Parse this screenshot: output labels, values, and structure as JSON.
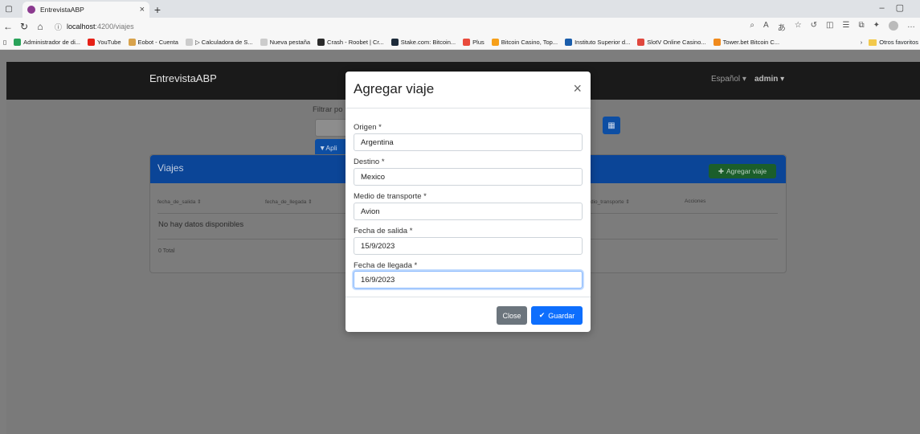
{
  "browser": {
    "tab_title": "EntrevistaABP",
    "url_host": "localhost",
    "url_path": ":4200/viajes",
    "bookmarks": [
      {
        "label": "Administrador de di...",
        "color": "#2aa35a"
      },
      {
        "label": "YouTube",
        "color": "#e62117"
      },
      {
        "label": "Eobot - Cuenta",
        "color": "#d8a24c"
      },
      {
        "label": "▷ Calculadora de S...",
        "color": "#cccccc"
      },
      {
        "label": "Nueva pestaña",
        "color": "#cccccc"
      },
      {
        "label": "Crash - Roobet | Cr...",
        "color": "#2b2b2b"
      },
      {
        "label": "Stake.com: Bitcoin...",
        "color": "#1d2b3a"
      },
      {
        "label": "Plus",
        "color": "#e94b3c"
      },
      {
        "label": "Bitcoin Casino, Top...",
        "color": "#f6a01a"
      },
      {
        "label": "Instituto Superior d...",
        "color": "#1a5dab"
      },
      {
        "label": "SlotV Online Casino...",
        "color": "#e0483e"
      },
      {
        "label": "Tower.bet Bitcoin C...",
        "color": "#f08a1c"
      }
    ],
    "other_favorites": "Otros favoritos"
  },
  "navbar": {
    "brand": "EntrevistaABP",
    "language": "Español ▾",
    "user": "admin ▾"
  },
  "filter": {
    "label": "Filtrar po",
    "apply_label": "Apli"
  },
  "card": {
    "title": "Viajes",
    "add_label": "Agregar viaje",
    "columns": [
      "fecha_de_salida ⇕",
      "fecha_de_llegada ⇕",
      "dio_transporte ⇕",
      "Acciones"
    ],
    "empty_message": "No hay datos disponibles",
    "total": "0 Total"
  },
  "modal": {
    "title": "Agregar viaje",
    "fields": [
      {
        "label": "Origen *",
        "value": "Argentina"
      },
      {
        "label": "Destino *",
        "value": "Mexico"
      },
      {
        "label": "Medio de transporte *",
        "value": "Avion"
      },
      {
        "label": "Fecha de salida *",
        "value": "15/9/2023"
      },
      {
        "label": "Fecha de llegada *",
        "value": "16/9/2023"
      }
    ],
    "close_label": "Close",
    "save_label": "Guardar"
  }
}
